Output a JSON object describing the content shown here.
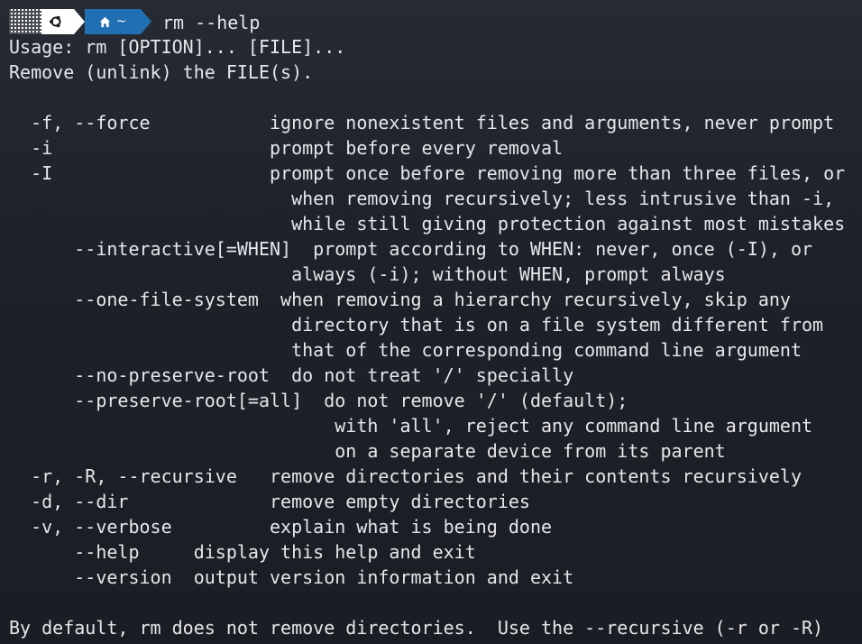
{
  "prompt": {
    "os_icon": "ubuntu-icon",
    "dir_icon": "home-icon",
    "directory": "~",
    "command": "rm --help",
    "colors": {
      "os_segment": "#ffffff",
      "dir_segment": "#1f6fb2",
      "text": "#e6e7ea",
      "background": "#1e2129"
    }
  },
  "output_lines": [
    "Usage: rm [OPTION]... [FILE]...",
    "Remove (unlink) the FILE(s).",
    "",
    "  -f, --force           ignore nonexistent files and arguments, never prompt",
    "  -i                    prompt before every removal",
    "  -I                    prompt once before removing more than three files, or",
    "                          when removing recursively; less intrusive than -i,",
    "                          while still giving protection against most mistakes",
    "      --interactive[=WHEN]  prompt according to WHEN: never, once (-I), or",
    "                          always (-i); without WHEN, prompt always",
    "      --one-file-system  when removing a hierarchy recursively, skip any",
    "                          directory that is on a file system different from",
    "                          that of the corresponding command line argument",
    "      --no-preserve-root  do not treat '/' specially",
    "      --preserve-root[=all]  do not remove '/' (default);",
    "                              with 'all', reject any command line argument",
    "                              on a separate device from its parent",
    "  -r, -R, --recursive   remove directories and their contents recursively",
    "  -d, --dir             remove empty directories",
    "  -v, --verbose         explain what is being done",
    "      --help     display this help and exit",
    "      --version  output version information and exit",
    "",
    "By default, rm does not remove directories.  Use the --recursive (-r or -R)"
  ]
}
